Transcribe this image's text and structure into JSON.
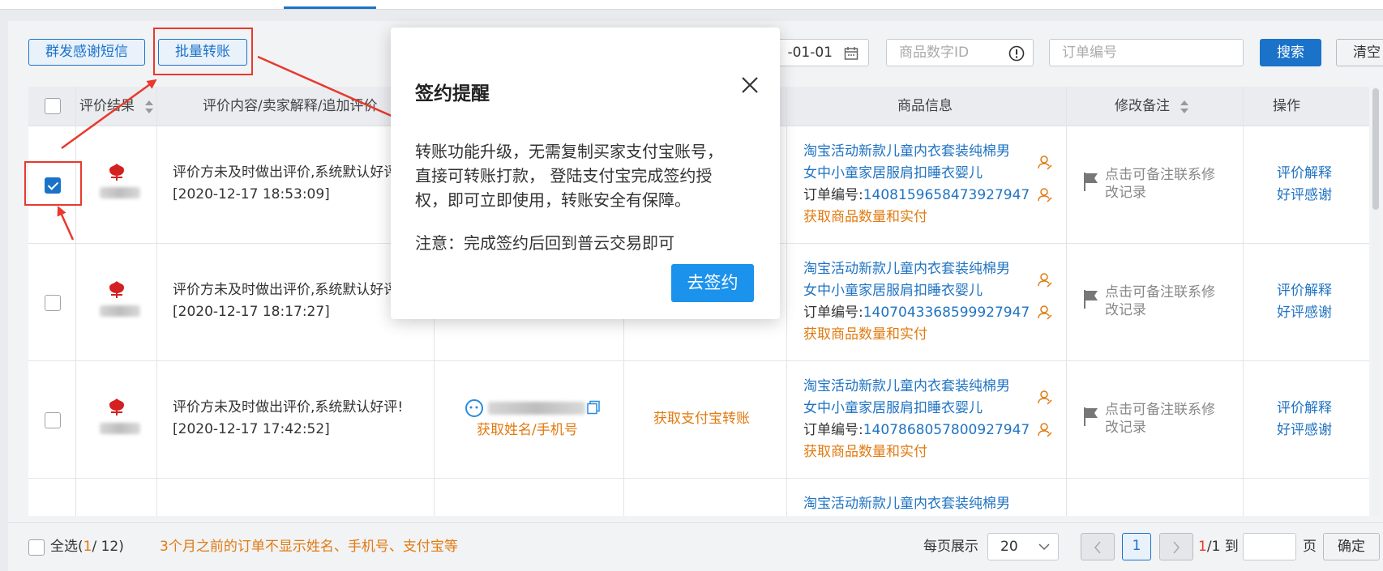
{
  "toolbar": {
    "group_sms_label": "群发感谢短信",
    "batch_transfer_label": "批量转账",
    "date_value": "-01-01",
    "product_id_placeholder": "商品数字ID",
    "order_no_placeholder": "订单编号",
    "search_label": "搜索",
    "clear_label": "清空"
  },
  "table": {
    "headers": [
      "评价结果",
      "评价内容/卖家解释/追加评价",
      "商品信息",
      "修改备注",
      "操作"
    ],
    "rows": [
      {
        "review_text": "评价方未及时做出评价,系统默认好评!",
        "review_time": "[2020-12-17 18:53:09]",
        "product_title_1": "淘宝活动新款儿童内衣套装纯棉男",
        "product_title_2": "女中小童家居服肩扣睡衣婴儿",
        "order_label": "订单编号:",
        "order_no": "1408159658473927947",
        "fetch_qty": "获取商品数量和实付",
        "remark_1": "点击可备注联系修",
        "remark_2": "改记录",
        "action_explain": "评价解释",
        "action_thanks": "好评感谢"
      },
      {
        "review_text": "评价方未及时做出评价,系统默认好评!",
        "review_time": "[2020-12-17 18:17:27]",
        "product_title_1": "淘宝活动新款儿童内衣套装纯棉男",
        "product_title_2": "女中小童家居服肩扣睡衣婴儿",
        "order_label": "订单编号:",
        "order_no": "1407043368599927947",
        "fetch_qty": "获取商品数量和实付",
        "remark_1": "点击可备注联系修",
        "remark_2": "改记录",
        "action_explain": "评价解释",
        "action_thanks": "好评感谢"
      },
      {
        "review_text": "评价方未及时做出评价,系统默认好评!",
        "review_time": "[2020-12-17 17:42:52]",
        "fetch_name_phone": "获取姓名/手机号",
        "fetch_alipay": "获取支付宝转账",
        "product_title_1": "淘宝活动新款儿童内衣套装纯棉男",
        "product_title_2": "女中小童家居服肩扣睡衣婴儿",
        "order_label": "订单编号:",
        "order_no": "1407868057800927947",
        "fetch_qty": "获取商品数量和实付",
        "remark_1": "点击可备注联系修",
        "remark_2": "改记录",
        "action_explain": "评价解释",
        "action_thanks": "好评感谢"
      },
      {
        "product_title_1": "淘宝活动新款儿童内衣套装纯棉男"
      }
    ]
  },
  "footer": {
    "select_all": "全选(",
    "selected": "1",
    "total": "/ 12)",
    "notice": "3个月之前的订单不显示姓名、手机号、支付宝等",
    "per_page_label": "每页展示",
    "per_page_value": "20",
    "current_page": "1",
    "page_current": "1",
    "page_total": "/1",
    "goto_label": "到",
    "page_unit": "页",
    "confirm_label": "确定"
  },
  "modal": {
    "title": "签约提醒",
    "body_1": "转账功能升级，无需复制买家支付宝账号，",
    "body_2": "直接可转账打款， 登陆支付宝完成签约授",
    "body_3": "权，即可立即使用，转账安全有保障。",
    "note": "注意：完成签约后回到普云交易即可",
    "confirm": "去签约"
  },
  "colors": {
    "primary": "#1a73c9",
    "link": "#1f73c2",
    "orange": "#e07b12",
    "annotation_red": "#e8392d",
    "modal_button": "#1b92ec"
  }
}
